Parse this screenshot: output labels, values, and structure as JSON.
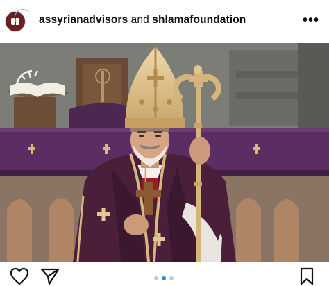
{
  "post": {
    "author_primary": "assyrianadvisors",
    "joiner": " and ",
    "author_secondary": "shlamafoundation",
    "more_label": "•••"
  },
  "carousel": {
    "slide_count": 3,
    "active_index": 1
  },
  "icons": {
    "more": "more-options-icon",
    "like": "heart-icon",
    "share": "paper-plane-icon",
    "save": "bookmark-icon"
  },
  "colors": {
    "altar_cloth": "#5b2d63",
    "vestment": "#4a1f3a",
    "gold": "#d9b77a",
    "carousel_active": "#1a8cf0"
  }
}
